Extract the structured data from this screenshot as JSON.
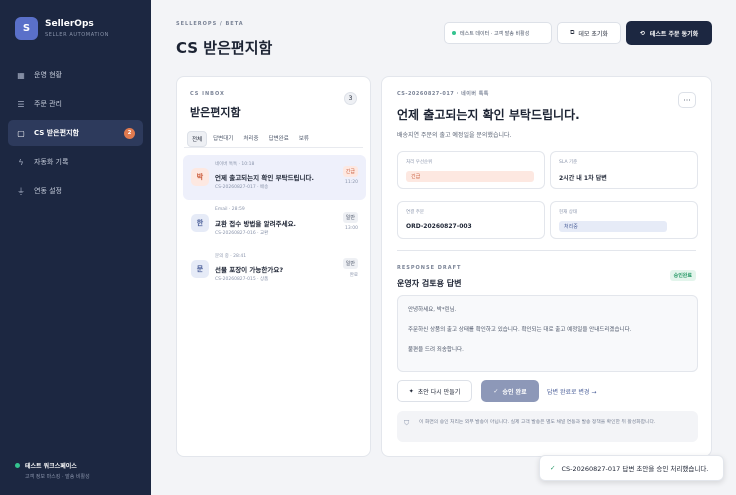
{
  "app": {
    "name": "SellerOps",
    "subtitle": "SELLER AUTOMATION",
    "logo_letter": "S"
  },
  "sidebar": {
    "items": [
      {
        "label": "운영 현황",
        "icon": "grid-icon"
      },
      {
        "label": "주문 관리",
        "icon": "list-icon"
      },
      {
        "label": "CS 받은편지함",
        "icon": "chat-icon",
        "badge": "2"
      },
      {
        "label": "자동화 기록",
        "icon": "bolt-icon"
      },
      {
        "label": "연동 설정",
        "icon": "plug-icon"
      }
    ],
    "workspace_title": "테스트 워크스페이스",
    "workspace_sub": "고객 정보 마스킹 · 발송 비활성"
  },
  "header": {
    "breadcrumb": "SELLEROPS / BETA",
    "title": "CS 받은편지함",
    "badge": "테스트 데이터 · 고객 발송 비활성",
    "reset_button": "데모 초기화",
    "sync_button": "테스트 주문 동기화"
  },
  "inbox": {
    "label": "CS INBOX",
    "title": "받은편지함",
    "count": "3",
    "filters": [
      "전체",
      "답변대기",
      "처리중",
      "답변완료",
      "보류"
    ],
    "messages": [
      {
        "avatar": "박",
        "meta": "네이버 톡톡 · 10:18",
        "subject": "언제 출고되는지 확인 부탁드립니다.",
        "id": "CS-20260827-017 · 배송",
        "tag": "긴급",
        "time": "11:20",
        "tone": "red"
      },
      {
        "avatar": "한",
        "meta": "Email · 28:59",
        "subject": "교환 접수 방법을 알려주세요.",
        "id": "CS-20260827-016 · 교환",
        "tag": "일반",
        "time": "13:00",
        "tone": "blue"
      },
      {
        "avatar": "문",
        "meta": "문의 중 · 28:41",
        "subject": "선물 포장이 가능한가요?",
        "id": "CS-20260827-015 · 상품",
        "tag": "일반",
        "time": "완료",
        "tone": "blue"
      }
    ]
  },
  "detail": {
    "label": "CS-20260827-017 · 네이버 톡톡",
    "title": "언제 출고되는지 확인 부탁드립니다.",
    "desc": "배송지연 주문의 출고 예정일을 문의했습니다.",
    "info": [
      {
        "label": "처리 우선순위",
        "pill": "긴급",
        "tone": "red"
      },
      {
        "label": "SLA 기준",
        "value": "2시간 내 1차 답변"
      },
      {
        "label": "연결 주문",
        "value": "ORD-20260827-003"
      },
      {
        "label": "현재 상태",
        "pill": "처리중",
        "tone": "blue"
      }
    ],
    "draft_label": "RESPONSE DRAFT",
    "draft_title": "운영자 검토용 답변",
    "approved_badge": "승인완료",
    "draft_lines": [
      "안녕하세요, 박*린님.",
      "주문하신 상품의 출고 상태를 확인하고 있습니다. 확인되는 대로 출고 예정일을 안내드리겠습니다.",
      "불편을 드려 죄송합니다."
    ],
    "regen_button": "초안 다시 만들기",
    "approve_button": "승인 완료",
    "change_link": "답변 완료로 변경 →",
    "notice": "이 화면의 승인 처리는 외부 발송이 아닙니다. 실제 고객 발송은 별도 채널 연동과 발송 정책을 확인한 뒤 활성화합니다."
  },
  "toast": {
    "text": "CS-20260827-017 답변 초안을 승인 처리했습니다."
  }
}
